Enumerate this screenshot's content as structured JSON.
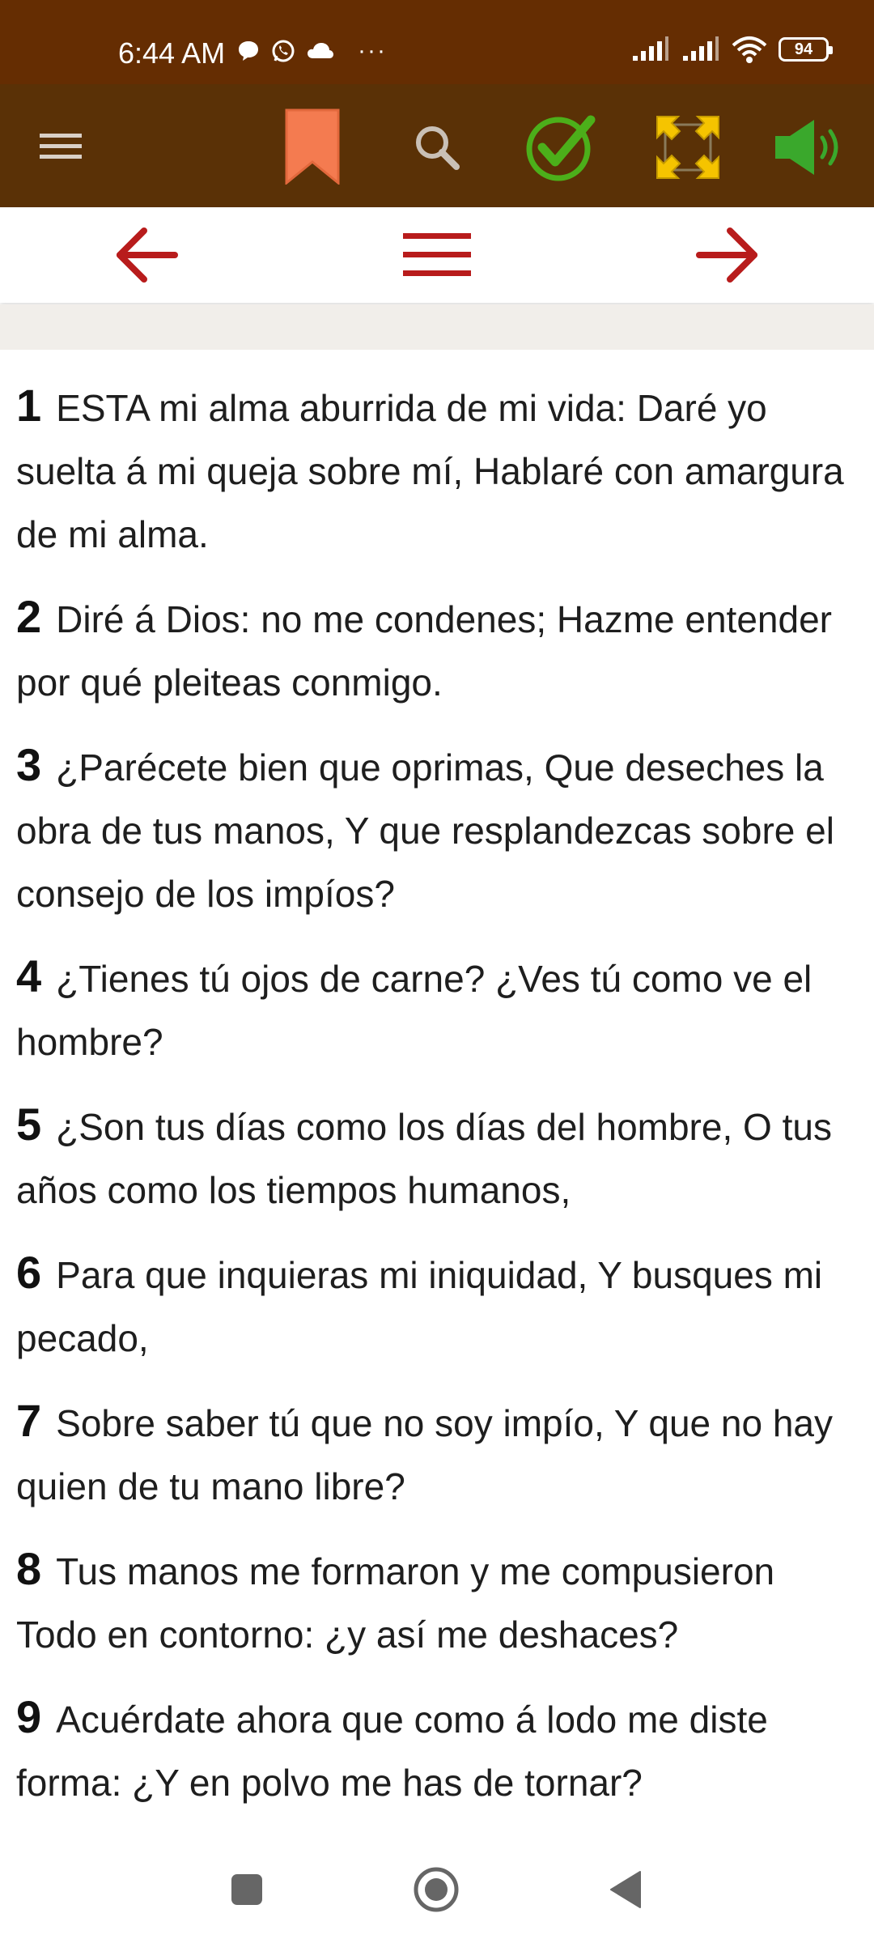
{
  "status_bar": {
    "time": "6:44 AM",
    "more": "···",
    "battery": "94"
  },
  "toolbar": {
    "icons": [
      "menu-icon",
      "bookmark-icon",
      "search-icon",
      "check-icon",
      "fullscreen-icon",
      "speaker-icon"
    ]
  },
  "navigation": {
    "icons": [
      "arrow-left-icon",
      "menu-icon",
      "arrow-right-icon"
    ],
    "accent_color": "#b81c1c"
  },
  "colors": {
    "status_bar": "#652d02",
    "toolbar": "#5a3106",
    "bookmark": "#f47b50",
    "check": "#4caf1a",
    "fullscreen": "#f5c400",
    "speaker": "#3aa82c"
  },
  "verses": [
    {
      "num": "1",
      "text": "ESTA mi alma aburrida de mi vida: Daré yo suelta á mi queja sobre mí, Hablaré con amargura de mi alma."
    },
    {
      "num": "2",
      "text": "Diré á Dios: no me condenes; Hazme entender por qué pleiteas conmigo."
    },
    {
      "num": "3",
      "text": "¿Parécete bien que oprimas, Que deseches la obra de tus manos, Y que resplandezcas sobre el consejo de los impíos?"
    },
    {
      "num": "4",
      "text": "¿Tienes tú ojos de carne? ¿Ves tú como ve el hombre?"
    },
    {
      "num": "5",
      "text": "¿Son tus días como los días del hombre, O tus años como los tiempos humanos,"
    },
    {
      "num": "6",
      "text": "Para que inquieras mi iniquidad, Y busques mi pecado,"
    },
    {
      "num": "7",
      "text": "Sobre saber tú que no soy impío, Y que no hay quien de tu mano libre?"
    },
    {
      "num": "8",
      "text": "Tus manos me formaron y me compusieron Todo en contorno: ¿y así me deshaces?"
    },
    {
      "num": "9",
      "text": "Acuérdate ahora que como á lodo me diste forma: ¿Y en polvo me has de tornar?"
    }
  ],
  "system_nav": {
    "icons": [
      "recents-icon",
      "home-icon",
      "back-icon"
    ]
  }
}
